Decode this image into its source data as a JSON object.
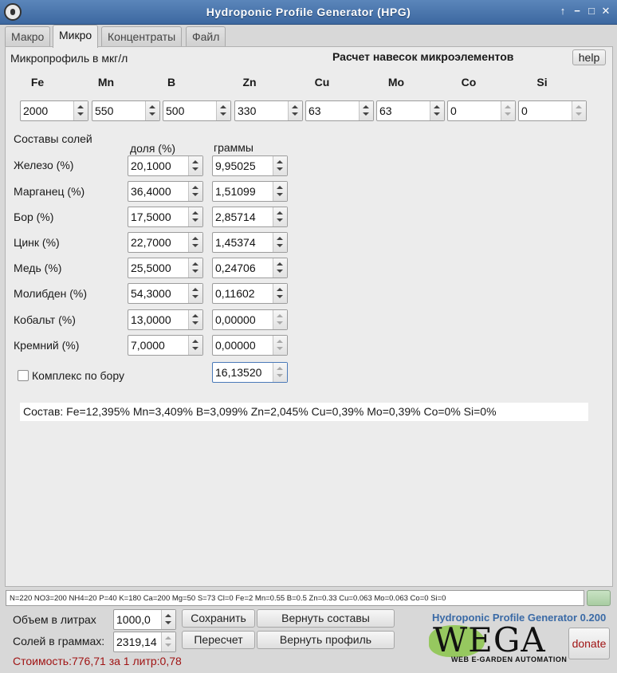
{
  "window": {
    "title": "Hydroponic Profile Generator (HPG)",
    "controls": [
      "↑",
      "−",
      "□",
      "✕"
    ]
  },
  "tabs": [
    {
      "label": "Макро",
      "active": false
    },
    {
      "label": "Микро",
      "active": true
    },
    {
      "label": "Концентраты",
      "active": false
    },
    {
      "label": "Файл",
      "active": false
    }
  ],
  "micro": {
    "profile_label": "Микропрофиль в мкг/л",
    "calc_title": "Расчет навесок микроэлементов",
    "help_label": "help",
    "elements": [
      {
        "symbol": "Fe",
        "value": "2000"
      },
      {
        "symbol": "Mn",
        "value": "550"
      },
      {
        "symbol": "B",
        "value": "500"
      },
      {
        "symbol": "Zn",
        "value": "330"
      },
      {
        "symbol": "Cu",
        "value": "63"
      },
      {
        "symbol": "Mo",
        "value": "63"
      },
      {
        "symbol": "Co",
        "value": "0"
      },
      {
        "symbol": "Si",
        "value": "0"
      }
    ],
    "salts_label": "Составы солей",
    "share_header": "доля (%)",
    "grams_header": "граммы",
    "salts": [
      {
        "label": "Железо (%)",
        "share": "20,1000",
        "grams": "9,95025"
      },
      {
        "label": "Марганец (%)",
        "share": "36,4000",
        "grams": "1,51099"
      },
      {
        "label": "Бор (%)",
        "share": "17,5000",
        "grams": "2,85714"
      },
      {
        "label": "Цинк (%)",
        "share": "22,7000",
        "grams": "1,45374"
      },
      {
        "label": "Медь (%)",
        "share": "25,5000",
        "grams": "0,24706"
      },
      {
        "label": "Молибден (%)",
        "share": "54,3000",
        "grams": "0,11602"
      },
      {
        "label": "Кобальт (%)",
        "share": "13,0000",
        "grams": "0,00000"
      },
      {
        "label": "Кремний (%)",
        "share": "7,0000",
        "grams": "0,00000"
      }
    ],
    "boron_complex": {
      "label": "Комплекс по бору",
      "checked": false,
      "value": "16,13520"
    },
    "summary": "Состав: Fe=12,395% Mn=3,409% B=3,099% Zn=2,045% Cu=0,39% Mo=0,39% Co=0% Si=0%"
  },
  "footer": {
    "formula": "N=220 NO3=200 NH4=20 P=40 K=180 Ca=200 Mg=50 S=73 Cl=0 Fe=2 Mn=0.55 B=0.5 Zn=0.33 Cu=0.063 Mo=0.063 Co=0 Si=0",
    "volume_label": "Объем в литрах",
    "volume_value": "1000,0",
    "salts_label": "Солей в граммах:",
    "salts_value": "2319,14",
    "save_label": "Сохранить",
    "recalc_label": "Пересчет",
    "restore_comp_label": "Вернуть составы",
    "restore_profile_label": "Вернуть профиль",
    "cost": "Стоимость:776,71 за 1 литр:0,78",
    "brand_title": "Hydroponic Profile Generator 0.200",
    "logo_text": "WEGA",
    "logo_sub": "WEB E-GARDEN AUTOMATION",
    "donate_label": "donate"
  }
}
